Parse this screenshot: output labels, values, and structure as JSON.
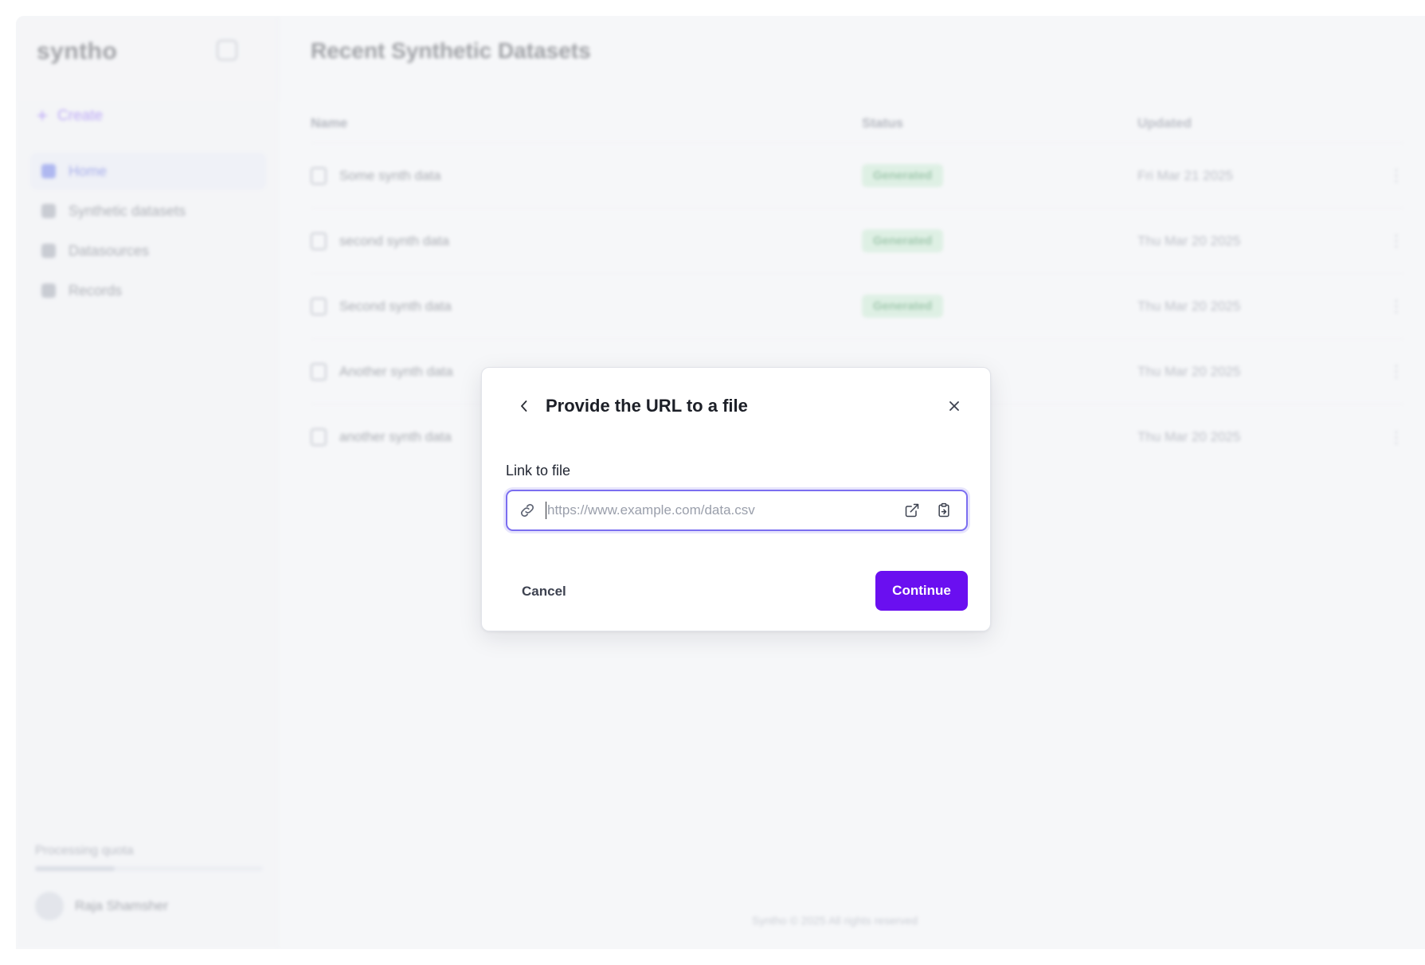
{
  "sidebar": {
    "logo": "syntho",
    "create_label": "Create",
    "items": [
      {
        "label": "Home",
        "active": true
      },
      {
        "label": "Synthetic datasets",
        "active": false
      },
      {
        "label": "Datasources",
        "active": false
      },
      {
        "label": "Records",
        "active": false
      }
    ],
    "footer_label": "Processing quota",
    "quota_fraction": 0.35,
    "user_name": "Raja Shamsher"
  },
  "main": {
    "title": "Recent Synthetic Datasets",
    "columns": [
      "Name",
      "Status",
      "Updated"
    ],
    "rows": [
      {
        "name": "Some synth data",
        "status": "Generated",
        "updated": "Fri Mar 21 2025",
        "more": "⋮"
      },
      {
        "name": "second synth data",
        "status": "Generated",
        "updated": "Thu Mar 20 2025",
        "more": "⋮"
      },
      {
        "name": "Second synth data",
        "status": "Generated",
        "updated": "Thu Mar 20 2025",
        "more": "⋮"
      },
      {
        "name": "Another synth data",
        "status": "",
        "updated": "Thu Mar 20 2025",
        "more": "⋮"
      },
      {
        "name": "another synth data",
        "status": "",
        "updated": "Thu Mar 20 2025",
        "more": "⋮"
      }
    ],
    "footer": "Syntho © 2025 All rights reserved"
  },
  "modal": {
    "title": "Provide the URL to a file",
    "field_label": "Link to file",
    "input_value": "",
    "input_placeholder": "https://www.example.com/data.csv",
    "cancel_label": "Cancel",
    "continue_label": "Continue",
    "accent_color": "#6a0ff0",
    "icons": {
      "back": "chevron-left-icon",
      "close": "close-icon",
      "link": "link-icon",
      "open": "external-link-icon",
      "paste": "clipboard-paste-icon"
    }
  }
}
